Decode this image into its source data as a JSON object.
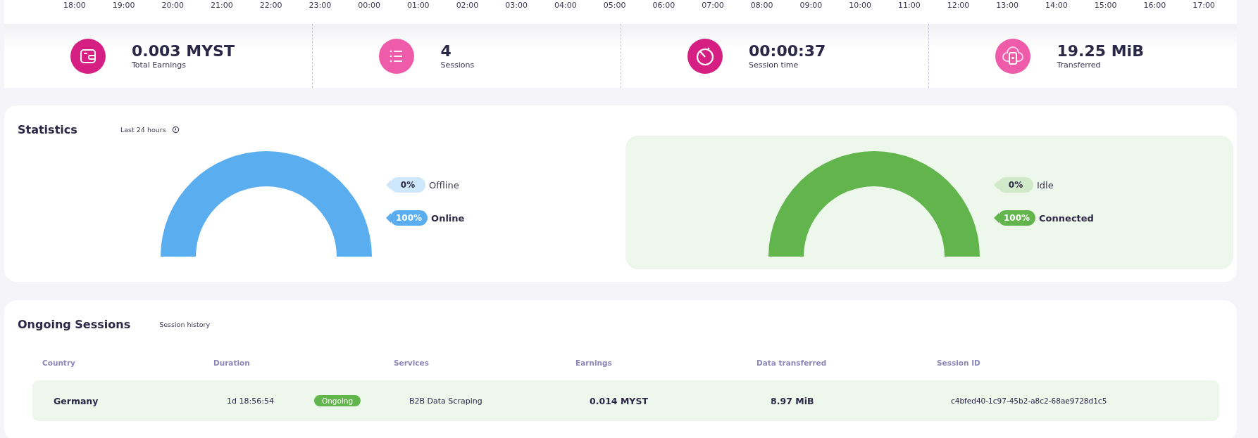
{
  "timeline": {
    "hours": [
      "18:00",
      "19:00",
      "20:00",
      "21:00",
      "22:00",
      "23:00",
      "00:00",
      "01:00",
      "02:00",
      "03:00",
      "04:00",
      "05:00",
      "06:00",
      "07:00",
      "08:00",
      "09:00",
      "10:00",
      "11:00",
      "12:00",
      "13:00",
      "14:00",
      "15:00",
      "16:00",
      "17:00"
    ]
  },
  "metrics": [
    {
      "kind": "wallet",
      "value": "0.003 MYST",
      "label": "Total Earnings",
      "color": "#d61f82"
    },
    {
      "kind": "list",
      "value": "4",
      "label": "Sessions",
      "color": "#ee5ba9"
    },
    {
      "kind": "timer",
      "value": "00:00:37",
      "label": "Session time",
      "color": "#d61f82"
    },
    {
      "kind": "cloud",
      "value": "19.25 MiB",
      "label": "Transferred",
      "color": "#ee5ba9"
    }
  ],
  "statistics": {
    "title": "Statistics",
    "period": "Last 24 hours",
    "gauges": [
      {
        "kind": "plain",
        "level": 1,
        "color": "#5aaeef",
        "legend": [
          {
            "percent": "0%",
            "label": "Offline",
            "highlighted": false
          },
          {
            "percent": "100%",
            "label": "Online",
            "highlighted": true
          }
        ]
      },
      {
        "kind": "panel",
        "level": 1,
        "color": "#62b54c",
        "legend": [
          {
            "percent": "0%",
            "label": "Idle",
            "highlighted": false
          },
          {
            "percent": "100%",
            "label": "Connected",
            "highlighted": true
          }
        ]
      }
    ]
  },
  "sessions": {
    "title": "Ongoing Sessions",
    "link": "Session history",
    "columns": [
      "Country",
      "Duration",
      "Services",
      "Earnings",
      "Data transferred",
      "Session ID"
    ],
    "rows": [
      {
        "country": "Germany",
        "duration": "1d 18:56:54",
        "status": "Ongoing",
        "services": "B2B Data Scraping",
        "earnings": "0.014 MYST",
        "data": "8.97 MiB",
        "session_id": "c4bfed40-1c97-45b2-a8c2-68ae9728d1c5"
      }
    ]
  }
}
